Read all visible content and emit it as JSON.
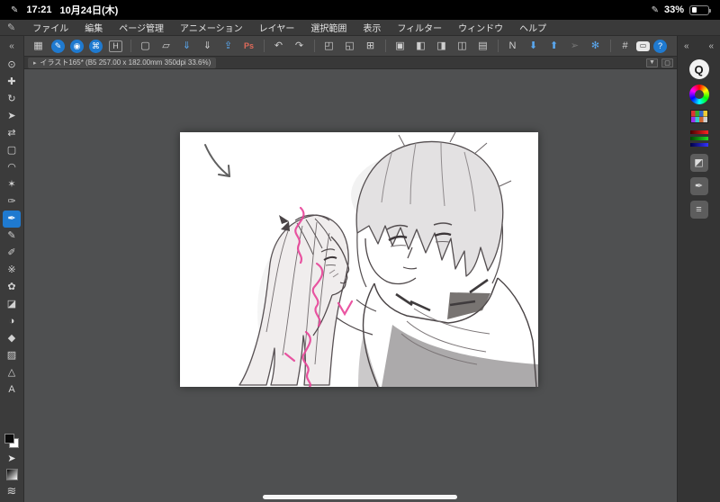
{
  "status_bar": {
    "left_icon": "✎",
    "time": "17:21",
    "date": "10月24日(木)",
    "pencil_icon": "✎",
    "battery_percent": "33%"
  },
  "menu_bar": {
    "app_icon": "✎",
    "items": [
      {
        "name": "menu-file",
        "label": "ファイル"
      },
      {
        "name": "menu-edit",
        "label": "編集"
      },
      {
        "name": "menu-page-management",
        "label": "ページ管理"
      },
      {
        "name": "menu-animation",
        "label": "アニメーション"
      },
      {
        "name": "menu-layer",
        "label": "レイヤー"
      },
      {
        "name": "menu-selection",
        "label": "選択範囲"
      },
      {
        "name": "menu-view",
        "label": "表示"
      },
      {
        "name": "menu-filter",
        "label": "フィルター"
      },
      {
        "name": "menu-window",
        "label": "ウィンドウ"
      },
      {
        "name": "menu-help",
        "label": "ヘルプ"
      }
    ]
  },
  "toolbar": {
    "icons": [
      {
        "name": "workspace-layout-icon",
        "glyph": "▦"
      },
      {
        "name": "pen-settings-icon",
        "glyph": "✎",
        "style": "blue-circle"
      },
      {
        "name": "touch-gesture-icon",
        "glyph": "◉",
        "style": "blue-circle"
      },
      {
        "name": "shortcut-keys-icon",
        "glyph": "⌘",
        "style": "blue-circle"
      },
      {
        "name": "hide-interface-icon",
        "glyph": "H",
        "style": "boxed"
      },
      {
        "name": "toolbar-separator",
        "sep": true
      },
      {
        "name": "new-file-icon",
        "glyph": "▢"
      },
      {
        "name": "open-file-icon",
        "glyph": "▱"
      },
      {
        "name": "save-icon",
        "glyph": "⇓",
        "style": "blue"
      },
      {
        "name": "save-as-icon",
        "glyph": "⇓"
      },
      {
        "name": "export-icon",
        "glyph": "⇪",
        "style": "blue"
      },
      {
        "name": "psd-export-icon",
        "glyph": "Ps",
        "style": "red"
      },
      {
        "name": "toolbar-separator",
        "sep": true
      },
      {
        "name": "undo-icon",
        "glyph": "↶"
      },
      {
        "name": "redo-icon",
        "glyph": "↷"
      },
      {
        "name": "toolbar-separator",
        "sep": true
      },
      {
        "name": "free-transform-icon",
        "glyph": "◰"
      },
      {
        "name": "scale-transform-icon",
        "glyph": "◱"
      },
      {
        "name": "mesh-transform-icon",
        "glyph": "⊞"
      },
      {
        "name": "toolbar-separator",
        "sep": true
      },
      {
        "name": "canvas-panel-icon",
        "glyph": "▣"
      },
      {
        "name": "flip-canvas-icon",
        "glyph": "◧"
      },
      {
        "name": "rotate-view-icon",
        "glyph": "◨"
      },
      {
        "name": "crop-view-icon",
        "glyph": "◫"
      },
      {
        "name": "snap-settings-icon",
        "glyph": "▤"
      },
      {
        "name": "toolbar-separator",
        "sep": true
      },
      {
        "name": "layer-blend-icon",
        "glyph": "N"
      },
      {
        "name": "layer-down-icon",
        "glyph": "⬇",
        "style": "blue"
      },
      {
        "name": "layer-up-icon",
        "glyph": "⬆",
        "style": "blue"
      },
      {
        "name": "publish-icon",
        "glyph": "➢",
        "style": "dim"
      },
      {
        "name": "effect-icon",
        "glyph": "✻",
        "style": "blue"
      },
      {
        "name": "toolbar-separator",
        "sep": true
      },
      {
        "name": "grid-toggle-icon",
        "glyph": "#"
      },
      {
        "name": "presentation-icon",
        "glyph": "▭",
        "style": "bright"
      },
      {
        "name": "help-icon",
        "glyph": "?",
        "style": "blue-circle"
      }
    ]
  },
  "left_toolbar": {
    "collapse_glyph": "«",
    "cursor_glyph": "➤",
    "waves_glyph": "≋",
    "tools": [
      {
        "name": "zoom-tool",
        "glyph": "⊙"
      },
      {
        "name": "move-canvas-tool",
        "glyph": "✚"
      },
      {
        "name": "rotate-canvas-tool",
        "glyph": "↻"
      },
      {
        "name": "operation-tool",
        "glyph": "➤"
      },
      {
        "name": "layer-move-tool",
        "glyph": "⇄"
      },
      {
        "name": "selection-tool",
        "glyph": "▢"
      },
      {
        "name": "lasso-tool",
        "glyph": "◠"
      },
      {
        "name": "auto-select-tool",
        "glyph": "✶"
      },
      {
        "name": "eyedropper-tool",
        "glyph": "✑"
      },
      {
        "name": "pen-tool",
        "glyph": "✒",
        "selected": true
      },
      {
        "name": "pencil-tool",
        "glyph": "✎"
      },
      {
        "name": "brush-tool",
        "glyph": "✐"
      },
      {
        "name": "airbrush-tool",
        "glyph": "※"
      },
      {
        "name": "decoration-tool",
        "glyph": "✿"
      },
      {
        "name": "eraser-tool",
        "glyph": "◪"
      },
      {
        "name": "blend-tool",
        "glyph": "◑"
      },
      {
        "name": "fill-tool",
        "glyph": "◆"
      },
      {
        "name": "gradient-tool",
        "glyph": "▨"
      },
      {
        "name": "figure-tool",
        "glyph": "△"
      },
      {
        "name": "text-tool",
        "glyph": "A"
      }
    ]
  },
  "tab_bar": {
    "indicator": "▸",
    "label": "イラスト165* (B5 257.00 x 182.00mm 350dpi 33.6%)",
    "controls": [
      {
        "name": "tab-dropdown-icon",
        "glyph": "▼"
      },
      {
        "name": "tab-detach-icon",
        "glyph": "▢"
      }
    ]
  },
  "right_panel": {
    "collapse_left": "«",
    "collapse_right": "«",
    "items": [
      {
        "name": "quick-access-icon",
        "glyph": "Q",
        "style": "qcircle"
      },
      {
        "name": "color-wheel-icon",
        "glyph": "",
        "style": "wheel"
      },
      {
        "name": "color-set-icon",
        "glyph": "",
        "style": "swatch-grid"
      },
      {
        "name": "color-slider-icon",
        "glyph": "",
        "style": "slider-bars"
      },
      {
        "name": "material-panel-icon",
        "glyph": "◩",
        "style": "gray-sq"
      },
      {
        "name": "sub-tool-panel-icon",
        "glyph": "✒",
        "style": "gray-sq"
      },
      {
        "name": "brush-size-panel-icon",
        "glyph": "≡",
        "style": "gray-sq"
      }
    ]
  }
}
